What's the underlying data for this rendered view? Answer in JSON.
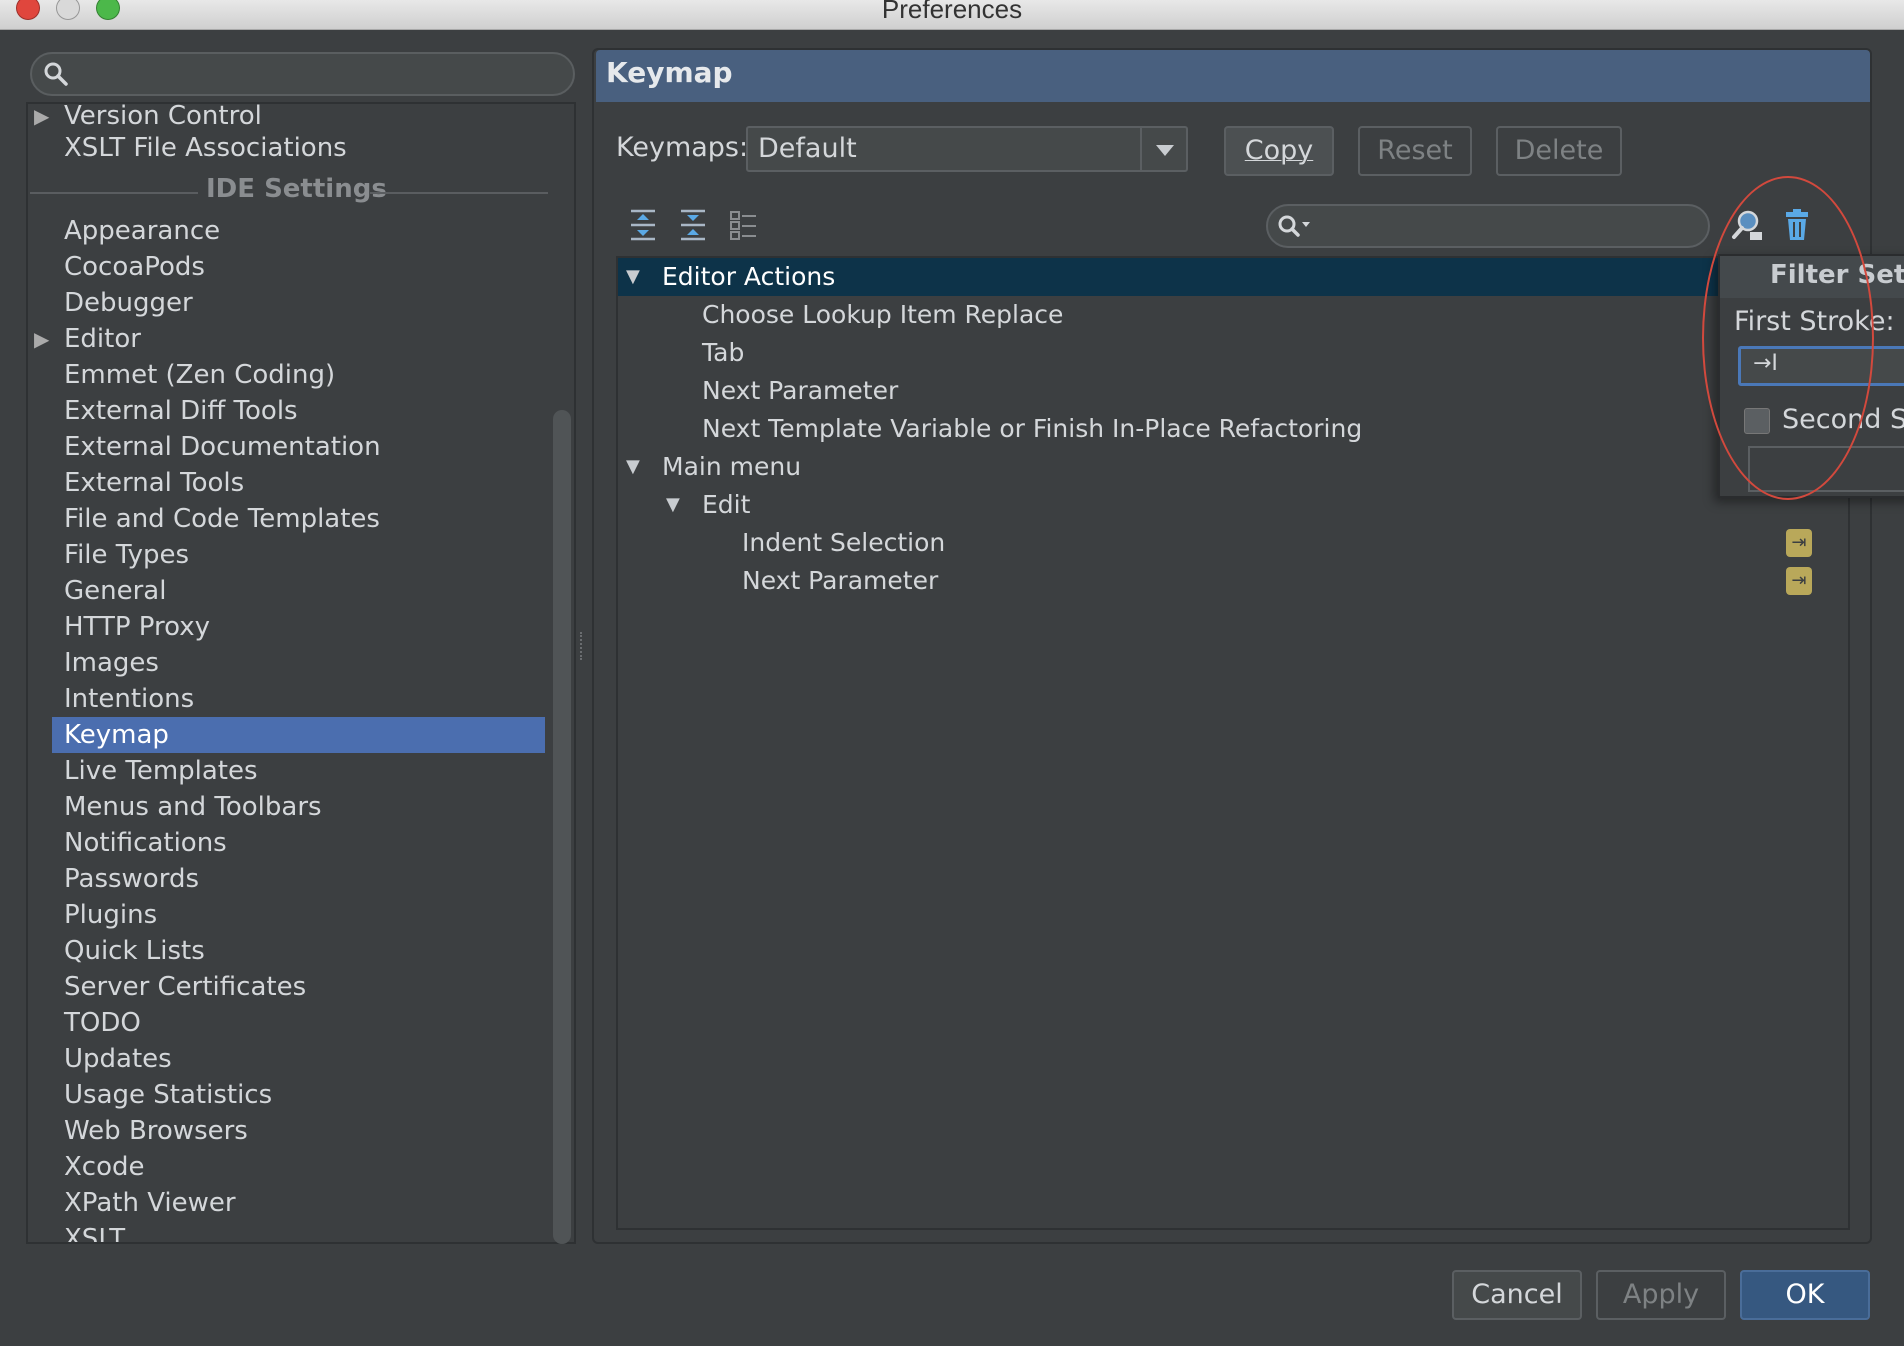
{
  "window": {
    "title": "Preferences"
  },
  "sidebar": {
    "search_placeholder": "",
    "project_items": [
      "Version Control",
      "XSLT File Associations"
    ],
    "section_label": "IDE Settings",
    "items": [
      {
        "label": "Appearance"
      },
      {
        "label": "CocoaPods"
      },
      {
        "label": "Debugger"
      },
      {
        "label": "Editor"
      },
      {
        "label": "Emmet (Zen Coding)"
      },
      {
        "label": "External Diff Tools"
      },
      {
        "label": "External Documentation"
      },
      {
        "label": "External Tools"
      },
      {
        "label": "File and Code Templates"
      },
      {
        "label": "File Types"
      },
      {
        "label": "General"
      },
      {
        "label": "HTTP Proxy"
      },
      {
        "label": "Images"
      },
      {
        "label": "Intentions"
      },
      {
        "label": "Keymap"
      },
      {
        "label": "Live Templates"
      },
      {
        "label": "Menus and Toolbars"
      },
      {
        "label": "Notifications"
      },
      {
        "label": "Passwords"
      },
      {
        "label": "Plugins"
      },
      {
        "label": "Quick Lists"
      },
      {
        "label": "Server Certificates"
      },
      {
        "label": "TODO"
      },
      {
        "label": "Updates"
      },
      {
        "label": "Usage Statistics"
      },
      {
        "label": "Web Browsers"
      },
      {
        "label": "Xcode"
      },
      {
        "label": "XPath Viewer"
      },
      {
        "label": "XSLT"
      }
    ],
    "selected": "Keymap"
  },
  "keymap": {
    "header": "Keymap",
    "keymaps_label": "Keymaps:",
    "keymap_value": "Default",
    "copy_label": "Copy",
    "reset_label": "Reset",
    "delete_label": "Delete",
    "filter_placeholder": "",
    "tree": {
      "editor_actions": "Editor Actions",
      "choose_lookup": "Choose Lookup Item Replace",
      "tab": "Tab",
      "next_parameter": "Next Parameter",
      "next_template": "Next Template Variable or Finish In-Place Refactoring",
      "main_menu": "Main menu",
      "edit": "Edit",
      "indent_selection": "Indent Selection",
      "next_parameter_2": "Next Parameter"
    }
  },
  "filter_popup": {
    "title": "Filter Settir",
    "first_stroke_label": "First Stroke:",
    "first_stroke_value": "→I",
    "second_stroke_label": "Second St"
  },
  "footer": {
    "cancel_label": "Cancel",
    "apply_label": "Apply",
    "ok_label": "OK"
  },
  "colors": {
    "selection": "#4b6eaf",
    "tree_selection": "#0d3349",
    "header": "#49607f",
    "highlight_ellipse": "#d2493d",
    "shortcut_badge": "#b9a85a"
  }
}
